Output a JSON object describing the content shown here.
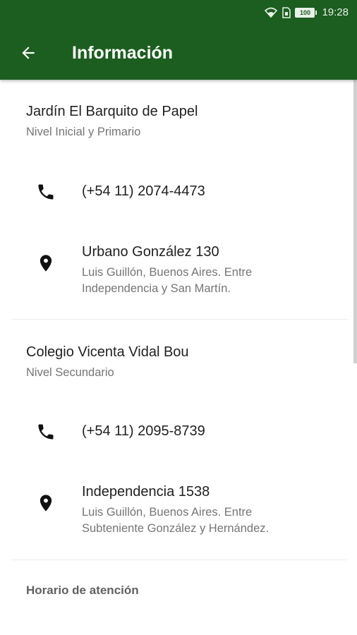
{
  "status_bar": {
    "time": "19:28",
    "battery": "100",
    "icons": [
      "wifi-icon",
      "sim-icon",
      "battery-icon"
    ]
  },
  "toolbar": {
    "title": "Información",
    "back_icon": "arrow-back-icon"
  },
  "colors": {
    "primary": "#1b5e1f",
    "text_primary": "#212121",
    "text_secondary": "#757575"
  },
  "schools": [
    {
      "name": "Jardín El Barquito de Papel",
      "level": "Nivel Inicial y Primario",
      "phone": "(+54 11) 2074-4473",
      "address": "Urbano González 130",
      "address_detail_1": "Luis Guillón, Buenos Aires. Entre",
      "address_detail_2": "Independencia y San Martín."
    },
    {
      "name": "Colegio Vicenta Vidal Bou",
      "level": "Nivel Secundario",
      "phone": "(+54 11) 2095-8739",
      "address": "Independencia 1538",
      "address_detail_1": "Luis Guillón, Buenos Aires. Entre",
      "address_detail_2": "Subteniente González y Hernández."
    }
  ],
  "hours_section": {
    "title": "Horario de atención"
  }
}
